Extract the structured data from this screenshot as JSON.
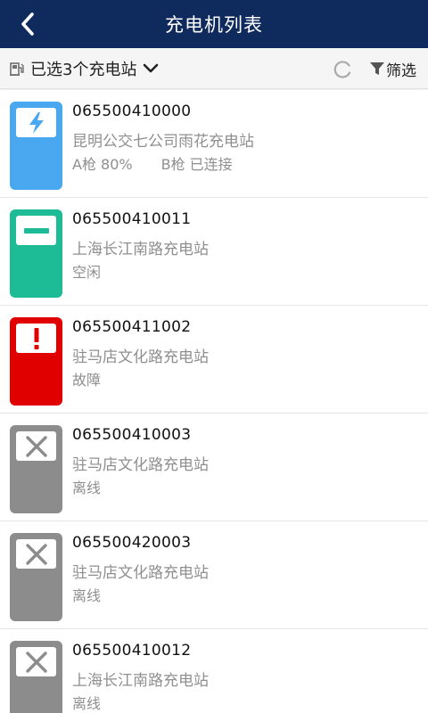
{
  "header": {
    "title": "充电机列表"
  },
  "toolbar": {
    "station_selector_label": "已选3个充电站",
    "filter_label": "筛选"
  },
  "colors": {
    "header_bg": "#0f2a5c",
    "charging": "#4aa8f0",
    "idle": "#1ebc96",
    "fault": "#e00000",
    "offline": "#8c8c8c"
  },
  "chargers": [
    {
      "code": "065500410000",
      "station": "昆明公交七公司雨花充电站",
      "state": "charging",
      "status_a": "A枪 80%",
      "status_b": "B枪 已连接"
    },
    {
      "code": "065500410011",
      "station": "上海长江南路充电站",
      "state": "idle",
      "status_a": "空闲",
      "status_b": ""
    },
    {
      "code": "065500411002",
      "station": "驻马店文化路充电站",
      "state": "fault",
      "status_a": "故障",
      "status_b": ""
    },
    {
      "code": "065500410003",
      "station": "驻马店文化路充电站",
      "state": "offline",
      "status_a": "离线",
      "status_b": ""
    },
    {
      "code": "065500420003",
      "station": "驻马店文化路充电站",
      "state": "offline",
      "status_a": "离线",
      "status_b": ""
    },
    {
      "code": "065500410012",
      "station": "上海长江南路充电站",
      "state": "offline",
      "status_a": "离线",
      "status_b": ""
    }
  ]
}
